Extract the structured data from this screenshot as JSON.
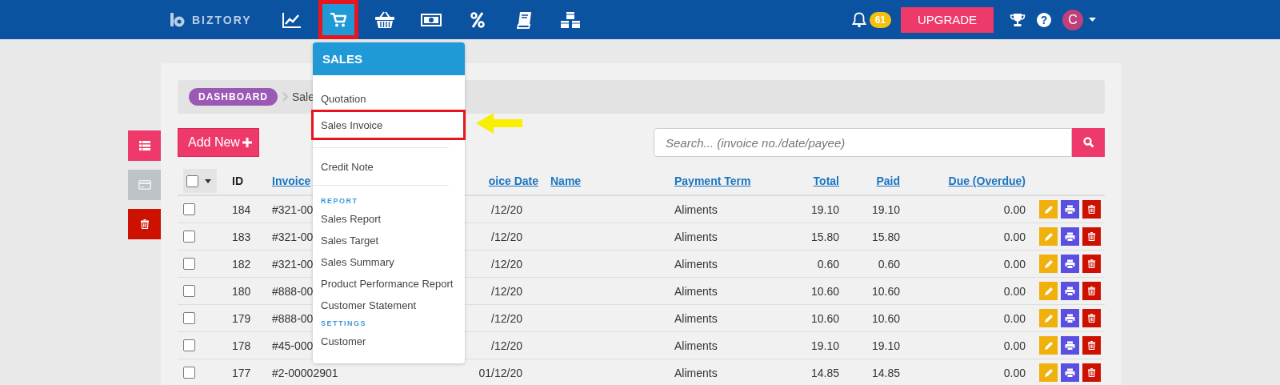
{
  "top_bar": {
    "logo": "BIZTORY",
    "nav": [
      {
        "kind": "chart",
        "selected": false,
        "highlighted": false
      },
      {
        "kind": "cart",
        "selected": true,
        "highlighted": true
      },
      {
        "kind": "basket",
        "selected": false,
        "highlighted": false
      },
      {
        "kind": "money",
        "selected": false,
        "highlighted": false
      },
      {
        "kind": "percent",
        "selected": false,
        "highlighted": false
      },
      {
        "kind": "book",
        "selected": false,
        "highlighted": false
      },
      {
        "kind": "cubes",
        "selected": false,
        "highlighted": false
      }
    ],
    "notification_count": "61",
    "upgrade": "UPGRADE",
    "help": "?",
    "avatar": "C"
  },
  "side_actions": [
    {
      "kind": "list"
    },
    {
      "kind": "card"
    },
    {
      "kind": "trash"
    }
  ],
  "breadcrumb": {
    "root": "DASHBOARD",
    "current": "Sale"
  },
  "add_button": "Add New",
  "search": {
    "placeholder": "Search... (invoice no./date/payee)"
  },
  "table": {
    "select_all": {
      "checked": false
    },
    "columns": [
      "ID",
      "Invoice",
      "oice Date",
      "Name",
      "Payment Term",
      "Total",
      "Paid",
      "Due (Overdue)"
    ],
    "rows": [
      {
        "checked": false,
        "id": "184",
        "invoice": "#321-00",
        "date": "/12/20",
        "name": "",
        "term": "Aliments",
        "total": "19.10",
        "paid": "19.10",
        "due": "0.00"
      },
      {
        "checked": false,
        "id": "183",
        "invoice": "#321-00",
        "date": "/12/20",
        "name": "",
        "term": "Aliments",
        "total": "15.80",
        "paid": "15.80",
        "due": "0.00"
      },
      {
        "checked": false,
        "id": "182",
        "invoice": "#321-00",
        "date": "/12/20",
        "name": "",
        "term": "Aliments",
        "total": "0.60",
        "paid": "0.60",
        "due": "0.00"
      },
      {
        "checked": false,
        "id": "180",
        "invoice": "#888-00",
        "date": "/12/20",
        "name": "",
        "term": "Aliments",
        "total": "10.60",
        "paid": "10.60",
        "due": "0.00"
      },
      {
        "checked": false,
        "id": "179",
        "invoice": "#888-00",
        "date": "/12/20",
        "name": "",
        "term": "Aliments",
        "total": "10.60",
        "paid": "10.60",
        "due": "0.00"
      },
      {
        "checked": false,
        "id": "178",
        "invoice": "#45-000",
        "date": "/12/20",
        "name": "",
        "term": "Aliments",
        "total": "19.10",
        "paid": "19.10",
        "due": "0.00"
      },
      {
        "checked": false,
        "id": "177",
        "invoice": "#2-00002901",
        "date": "01/12/20",
        "name": "",
        "term": "Aliments",
        "total": "14.85",
        "paid": "14.85",
        "due": "0.00"
      }
    ]
  },
  "menu": {
    "title": "SALES",
    "sections": [
      {
        "divider_before": false,
        "items": [
          {
            "label": "Quotation",
            "highlighted": false
          },
          {
            "label": "Sales Invoice",
            "highlighted": true
          }
        ]
      },
      {
        "divider_before": true,
        "items": [
          {
            "label": "Credit Note",
            "highlighted": false
          }
        ]
      },
      {
        "divider_before": true,
        "heading": "REPORT",
        "items": [
          {
            "label": "Sales Report",
            "highlighted": false
          },
          {
            "label": "Sales Target",
            "highlighted": false
          },
          {
            "label": "Sales Summary",
            "highlighted": false
          },
          {
            "label": "Product Performance Report",
            "highlighted": false
          },
          {
            "label": "Customer Statement",
            "highlighted": false
          }
        ]
      },
      {
        "divider_before": false,
        "heading": "SETTINGS",
        "items": [
          {
            "label": "Customer",
            "highlighted": false
          }
        ]
      }
    ]
  }
}
